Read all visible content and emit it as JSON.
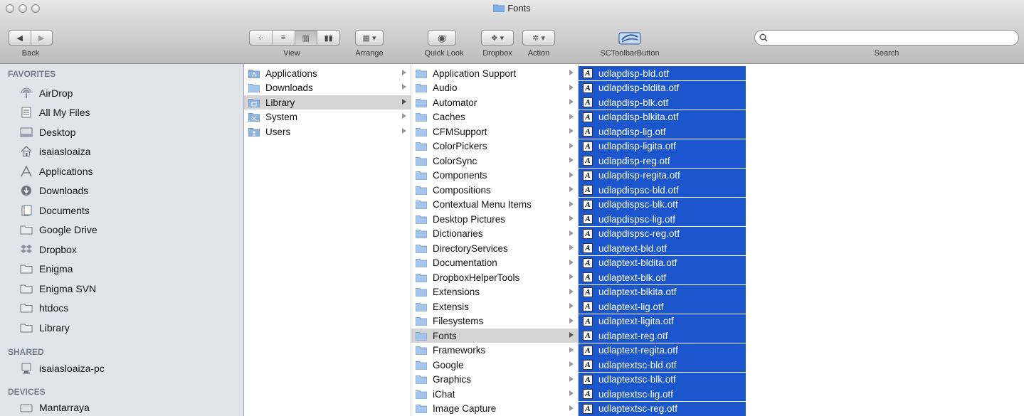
{
  "window": {
    "title": "Fonts"
  },
  "toolbar": {
    "back_label": "Back",
    "view_label": "View",
    "arrange_label": "Arrange",
    "quicklook_label": "Quick Look",
    "dropbox_label": "Dropbox",
    "action_label": "Action",
    "sctoolbar_label": "SCToolbarButton",
    "search_label": "Search",
    "search_value": ""
  },
  "sidebar": {
    "favorites_header": "FAVORITES",
    "favorites": [
      {
        "label": "AirDrop",
        "icon": "airdrop-icon"
      },
      {
        "label": "All My Files",
        "icon": "all-files-icon"
      },
      {
        "label": "Desktop",
        "icon": "desktop-icon"
      },
      {
        "label": "isaiasloaiza",
        "icon": "home-icon"
      },
      {
        "label": "Applications",
        "icon": "applications-icon"
      },
      {
        "label": "Downloads",
        "icon": "downloads-icon"
      },
      {
        "label": "Documents",
        "icon": "documents-icon"
      },
      {
        "label": "Google Drive",
        "icon": "folder-icon"
      },
      {
        "label": "Dropbox",
        "icon": "dropbox-icon"
      },
      {
        "label": "Enigma",
        "icon": "folder-icon"
      },
      {
        "label": "Enigma SVN",
        "icon": "folder-icon"
      },
      {
        "label": "htdocs",
        "icon": "folder-icon"
      },
      {
        "label": "Library",
        "icon": "folder-icon"
      }
    ],
    "shared_header": "SHARED",
    "shared": [
      {
        "label": "isaiasloaiza-pc",
        "icon": "computer-icon"
      }
    ],
    "devices_header": "DEVICES",
    "devices": [
      {
        "label": "Mantarraya",
        "icon": "drive-icon"
      }
    ]
  },
  "columns": {
    "root": [
      "Applications",
      "Downloads",
      "Library",
      "System",
      "Users"
    ],
    "library": [
      "Application Support",
      "Audio",
      "Automator",
      "Caches",
      "CFMSupport",
      "ColorPickers",
      "ColorSync",
      "Components",
      "Compositions",
      "Contextual Menu Items",
      "Desktop Pictures",
      "Dictionaries",
      "DirectoryServices",
      "Documentation",
      "DropboxHelperTools",
      "Extensions",
      "Extensis",
      "Filesystems",
      "Fonts",
      "Frameworks",
      "Google",
      "Graphics",
      "iChat",
      "Image Capture"
    ],
    "fonts": [
      "udlapdisp-bld.otf",
      "udlapdisp-bldita.otf",
      "udlapdisp-blk.otf",
      "udlapdisp-blkita.otf",
      "udlapdisp-lig.otf",
      "udlapdisp-ligita.otf",
      "udlapdisp-reg.otf",
      "udlapdisp-regita.otf",
      "udlapdispsc-bld.otf",
      "udlapdispsc-blk.otf",
      "udlapdispsc-lig.otf",
      "udlapdispsc-reg.otf",
      "udlaptext-bld.otf",
      "udlaptext-bldita.otf",
      "udlaptext-blk.otf",
      "udlaptext-blkita.otf",
      "udlaptext-lig.otf",
      "udlaptext-ligita.otf",
      "udlaptext-reg.otf",
      "udlaptext-regita.otf",
      "udlaptextsc-bld.otf",
      "udlaptextsc-blk.otf",
      "udlaptextsc-lig.otf",
      "udlaptextsc-reg.otf"
    ]
  },
  "colors": {
    "selection": "#1c56cc",
    "sidebar_bg": "#e0e5ec",
    "highlight_gray": "#d5d5d5"
  }
}
